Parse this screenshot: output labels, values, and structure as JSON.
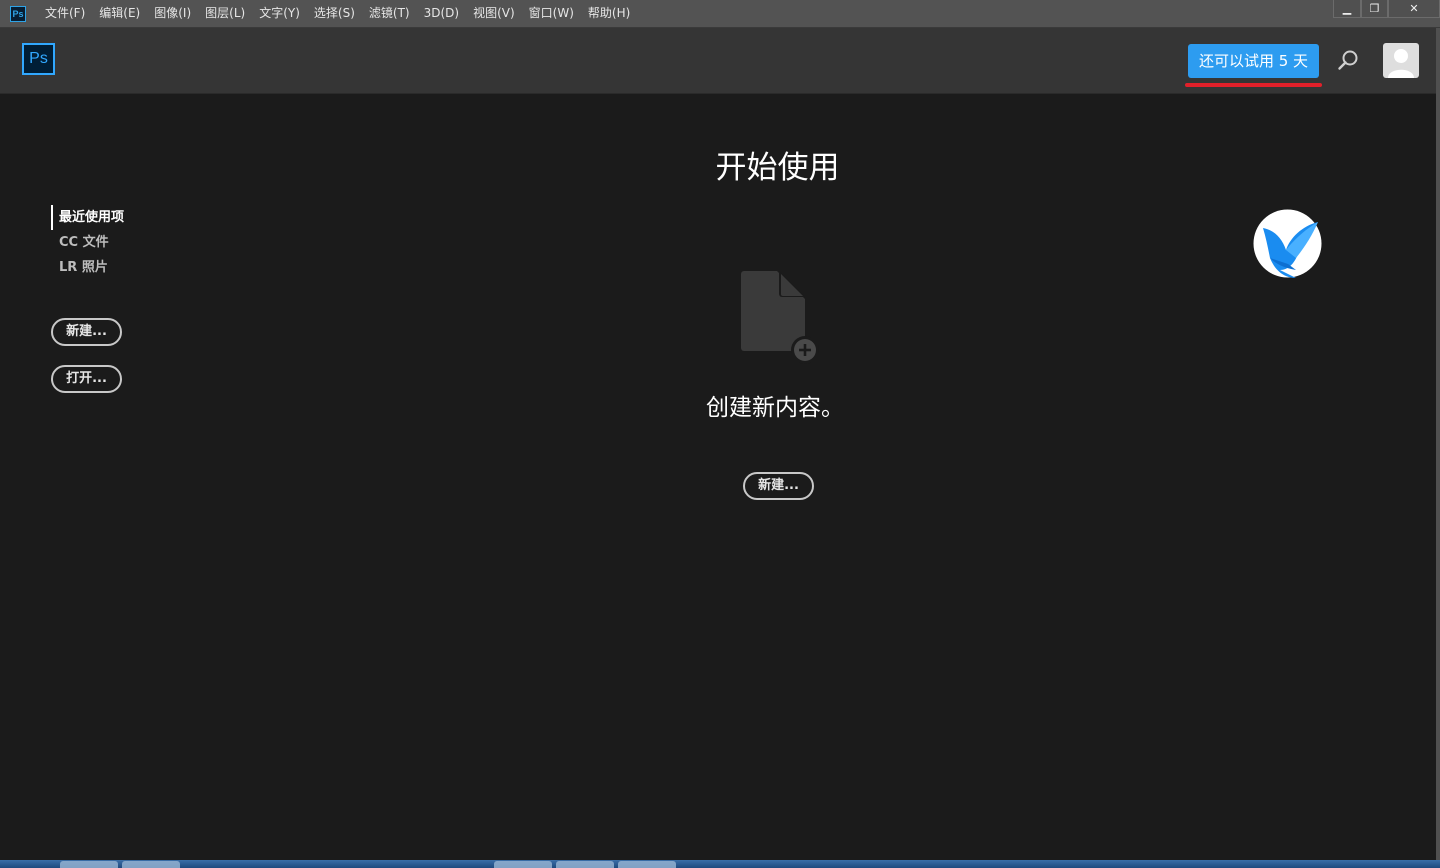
{
  "app": {
    "icon_text": "Ps",
    "logo_text": "Ps"
  },
  "menu": {
    "items": [
      {
        "label": "文件(F)"
      },
      {
        "label": "编辑(E)"
      },
      {
        "label": "图像(I)"
      },
      {
        "label": "图层(L)"
      },
      {
        "label": "文字(Y)"
      },
      {
        "label": "选择(S)"
      },
      {
        "label": "滤镜(T)"
      },
      {
        "label": "3D(D)"
      },
      {
        "label": "视图(V)"
      },
      {
        "label": "窗口(W)"
      },
      {
        "label": "帮助(H)"
      }
    ]
  },
  "window_controls": {
    "minimize": "▁",
    "restore": "❐",
    "close": "✕"
  },
  "header": {
    "trial_label": "还可以试用 5 天",
    "icons": [
      "search-icon",
      "user-avatar-icon"
    ],
    "colors": {
      "trial_button": "#2d9cf0",
      "highlight_underline": "#e2202a"
    }
  },
  "sidebar": {
    "items": [
      {
        "label": "最近使用项",
        "active": true
      },
      {
        "label": "CC 文件",
        "active": false
      },
      {
        "label": "LR 照片",
        "active": false
      }
    ],
    "new_button": "新建...",
    "open_button": "打开..."
  },
  "main": {
    "title": "开始使用",
    "create_text": "创建新内容。",
    "new_button": "新建...",
    "icons": [
      "new-document-icon",
      "bird-app-icon"
    ]
  },
  "colors": {
    "background": "#1b1b1b",
    "header": "#353535",
    "menubar": "#535353",
    "brand": "#31a8ff"
  }
}
